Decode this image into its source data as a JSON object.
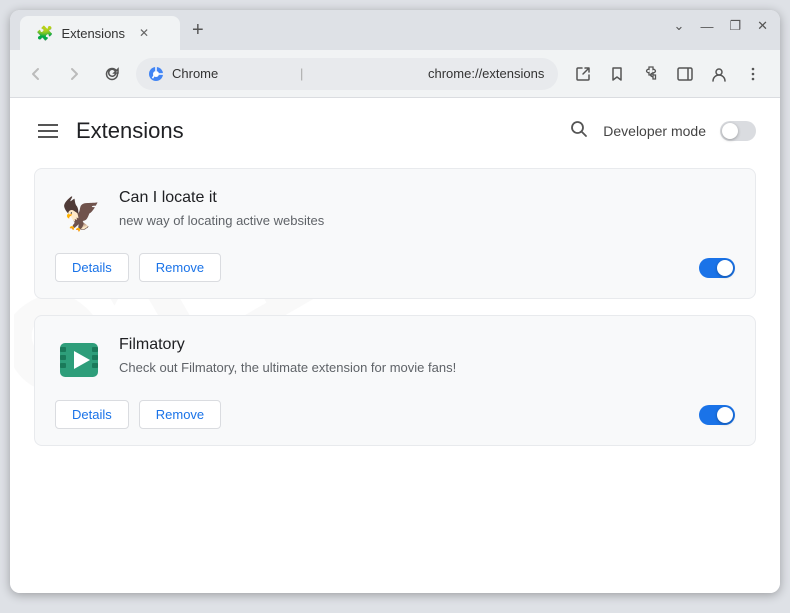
{
  "window": {
    "title": "Extensions",
    "tab_label": "Extensions",
    "close_label": "✕",
    "minimize_label": "—",
    "restore_label": "❐",
    "minimize_all": "⌄"
  },
  "address_bar": {
    "brand": "Chrome",
    "url": "chrome://extensions",
    "separator": "|"
  },
  "page": {
    "title": "Extensions",
    "developer_mode_label": "Developer mode"
  },
  "extensions": [
    {
      "name": "Can I locate it",
      "description": "new way of locating active websites",
      "details_label": "Details",
      "remove_label": "Remove",
      "enabled": true
    },
    {
      "name": "Filmatory",
      "description": "Check out Filmatory, the ultimate extension for movie fans!",
      "details_label": "Details",
      "remove_label": "Remove",
      "enabled": true
    }
  ]
}
